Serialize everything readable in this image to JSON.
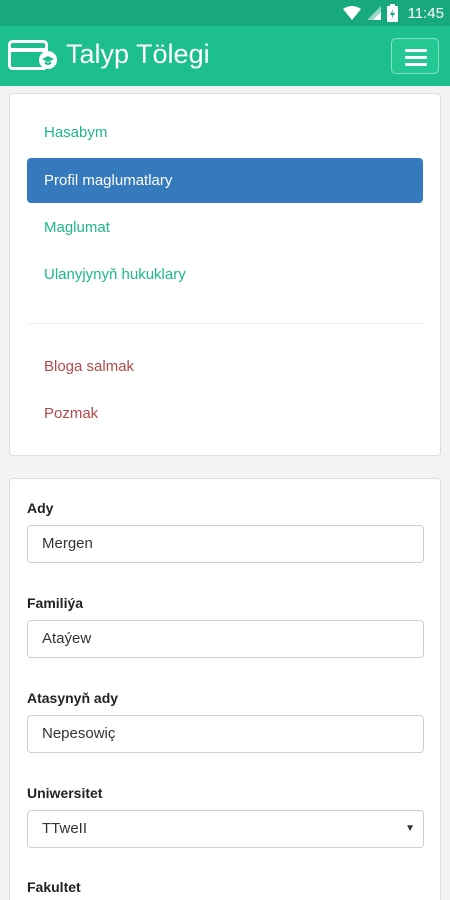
{
  "status_bar": {
    "time": "11:45"
  },
  "app_bar": {
    "title": "Talyp Tölegi"
  },
  "nav": {
    "items": [
      {
        "label": "Hasabym"
      },
      {
        "label": "Profil maglumatlary"
      },
      {
        "label": "Maglumat"
      },
      {
        "label": "Ulanyjynyň hukuklary"
      },
      {
        "label": "Bloga salmak"
      },
      {
        "label": "Pozmak"
      }
    ]
  },
  "form": {
    "first_name": {
      "label": "Ady",
      "value": "Mergen"
    },
    "last_name": {
      "label": "Familiýa",
      "value": "Ataýew"
    },
    "patronymic": {
      "label": "Atasynyň ady",
      "value": "Nepesowiç"
    },
    "university": {
      "label": "Uniwersitet",
      "value": "TTweII"
    },
    "faculty": {
      "label": "Fakultet"
    }
  },
  "colors": {
    "status_bar": "#17a97c",
    "app_bar": "#1dbf8e",
    "active_item": "#357abd",
    "link_green": "#1db98a",
    "link_red": "#b3494a"
  }
}
